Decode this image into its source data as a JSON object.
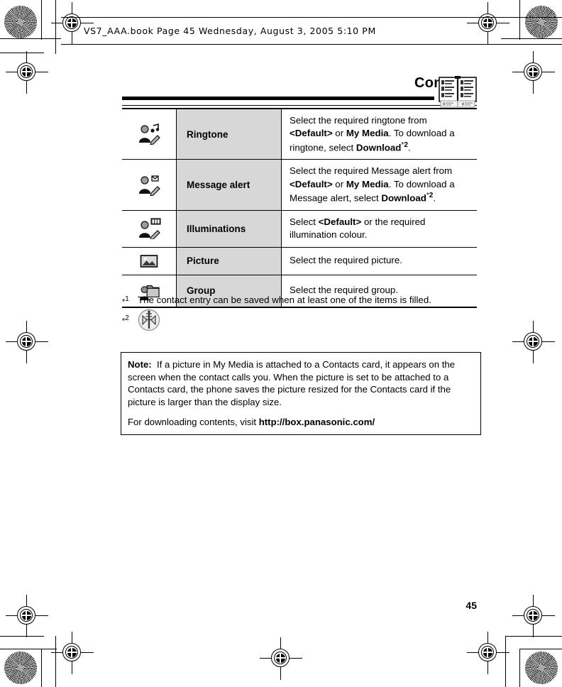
{
  "file_header": {
    "text": "VS7_AAA.book  Page 45  Wednesday,  August  3,  2005  5:10 PM"
  },
  "chapter": {
    "title": "Contacts",
    "icon": "open-book-icon"
  },
  "table": {
    "rows": [
      {
        "icon": "contact-ringtone-icon",
        "label": "Ringtone",
        "desc_html": "Select the required ringtone from <b>&lt;Default&gt;</b> or <b>My Media</b>. To download a ringtone, select <b>Download</b><sup class=\"fn\"><span class=\"star\">*</span>2</sup>.",
        "desc_text": "Select the required ringtone from <Default> or My Media. To download a ringtone, select Download*2."
      },
      {
        "icon": "contact-message-alert-icon",
        "label": "Message alert",
        "desc_html": "Select the required Message alert from <b>&lt;Default&gt;</b> or <b>My Media</b>. To download a Message alert, select <b>Download</b><sup class=\"fn\"><span class=\"star\">*</span>2</sup>.",
        "desc_text": "Select the required Message alert from <Default> or My Media. To download a Message alert, select Download*2."
      },
      {
        "icon": "contact-illuminations-icon",
        "label": "Illuminations",
        "desc_html": "Select <b>&lt;Default&gt;</b> or the required illumination colour.",
        "desc_text": "Select <Default> or the required illumination colour."
      },
      {
        "icon": "picture-icon",
        "label": "Picture",
        "desc_html": "Select the required picture.",
        "desc_text": "Select the required picture."
      },
      {
        "icon": "contact-group-icon",
        "label": "Group",
        "desc_html": "Select the required group.",
        "desc_text": "Select the required group."
      }
    ],
    "header_bg": "#d7d7d7"
  },
  "footnotes": [
    {
      "mark_star": "*",
      "mark_num": "1",
      "text": "The contact entry can be saved when at least one of the items is filled.",
      "icon": null
    },
    {
      "mark_star": "*",
      "mark_num": "2",
      "text": "",
      "icon": "network-download-icon"
    }
  ],
  "note": {
    "label": "Note:",
    "paragraph1_html": "<b>Note:</b>&nbsp; If a picture in My Media is attached to a Contacts card, it appears on the screen when the contact calls you. When the picture is set to be attached to a Contacts card, the phone saves the picture resized for the Contacts card if the picture is larger than the display size.",
    "paragraph1_text": "Note:  If a picture in My Media is attached to a Contacts card, it appears on the screen when the contact calls you. When the picture is set to be attached to a Contacts card, the phone saves the picture resized for the Contacts card if the picture is larger than the display size.",
    "paragraph2_html": "For downloading contents, visit <b>http://box.panasonic.com/</b>",
    "paragraph2_text": "For downloading contents, visit http://box.panasonic.com/",
    "url": "http://box.panasonic.com/"
  },
  "page_number": "45"
}
